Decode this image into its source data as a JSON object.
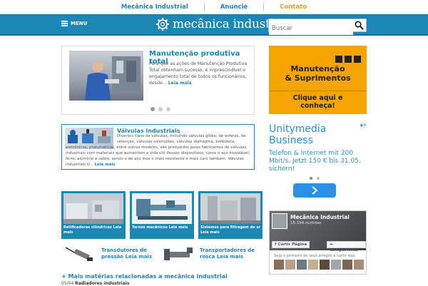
{
  "top_links": [
    "Mecânica Industrial",
    "Anuncie",
    "Contato"
  ],
  "header": {
    "menu_label": "MENU",
    "logo_text": "mecânica industrial",
    "search_placeholder": "Buscar"
  },
  "carousel": {
    "title": "Manutenção produtiva total",
    "text": "Para que as ações de Manutenção Produtiva Total obtenham sucesso, é imprescindível o engajamento total de todos os funcionários, desde...",
    "more": "Leia mais",
    "dots": 3,
    "active_dot": 0
  },
  "valvulas": {
    "title": "Válvulas industriais",
    "text_a": "Diversos tipos de válvulas, incluindo válvulas globo, de esferas, de",
    "text_b": "retenção, válvulas solenoides, válvulas diafragma, borboleta,",
    "text_c": "eletrônicas, pneumáticas, entre outros modelos, são produzidos pelos fabricantes de válvulas industriais com materiais que aumentam a vida útil desses dispositivos, como o aço inoxidável, ferro, alumínio e cobre, sendo o de aço inox o mais resistente e mais caro também.  Válvulas industriais O...",
    "more": "Leia mais"
  },
  "thumbs": [
    {
      "caption": "Retificadoras cilíndricas Leia mais"
    },
    {
      "caption": "Tornos mecânicos Leia mais"
    },
    {
      "caption": "Sistemas para filtragem do ar Leia mais"
    }
  ],
  "small_items": [
    {
      "title": "Transdutores de pressão Leia mais"
    },
    {
      "title": "Transportadores de rosca Leia mais"
    }
  ],
  "related": {
    "heading": "+ Mais matérias relacionadas a mecânica industrial",
    "news_date": "05/04",
    "news_title": "Radiadores industriais"
  },
  "ad1": {
    "title_line1": "Manutenção",
    "title_line2": "& Suprimentos",
    "cta": "Clique aqui e conheça!"
  },
  "ad2": {
    "marker": "▶✕",
    "title": "Unitymedia Business",
    "text": "Telefon & Internet mit 200 Mbit/s. Jetzt 150 € bis 31.05. sichern!"
  },
  "facebook": {
    "page_name": "Mecânica Industrial",
    "likes": "15.194 curtidas",
    "like_button": "Curtir Página",
    "share_button": "Compartilhar",
    "friends_text": "Seja o primeiro de seus amigos a curtir isso."
  },
  "colors": {
    "brand": "#1a87b5",
    "accent": "#e8a11a",
    "ad_orange": "#f5a500"
  }
}
